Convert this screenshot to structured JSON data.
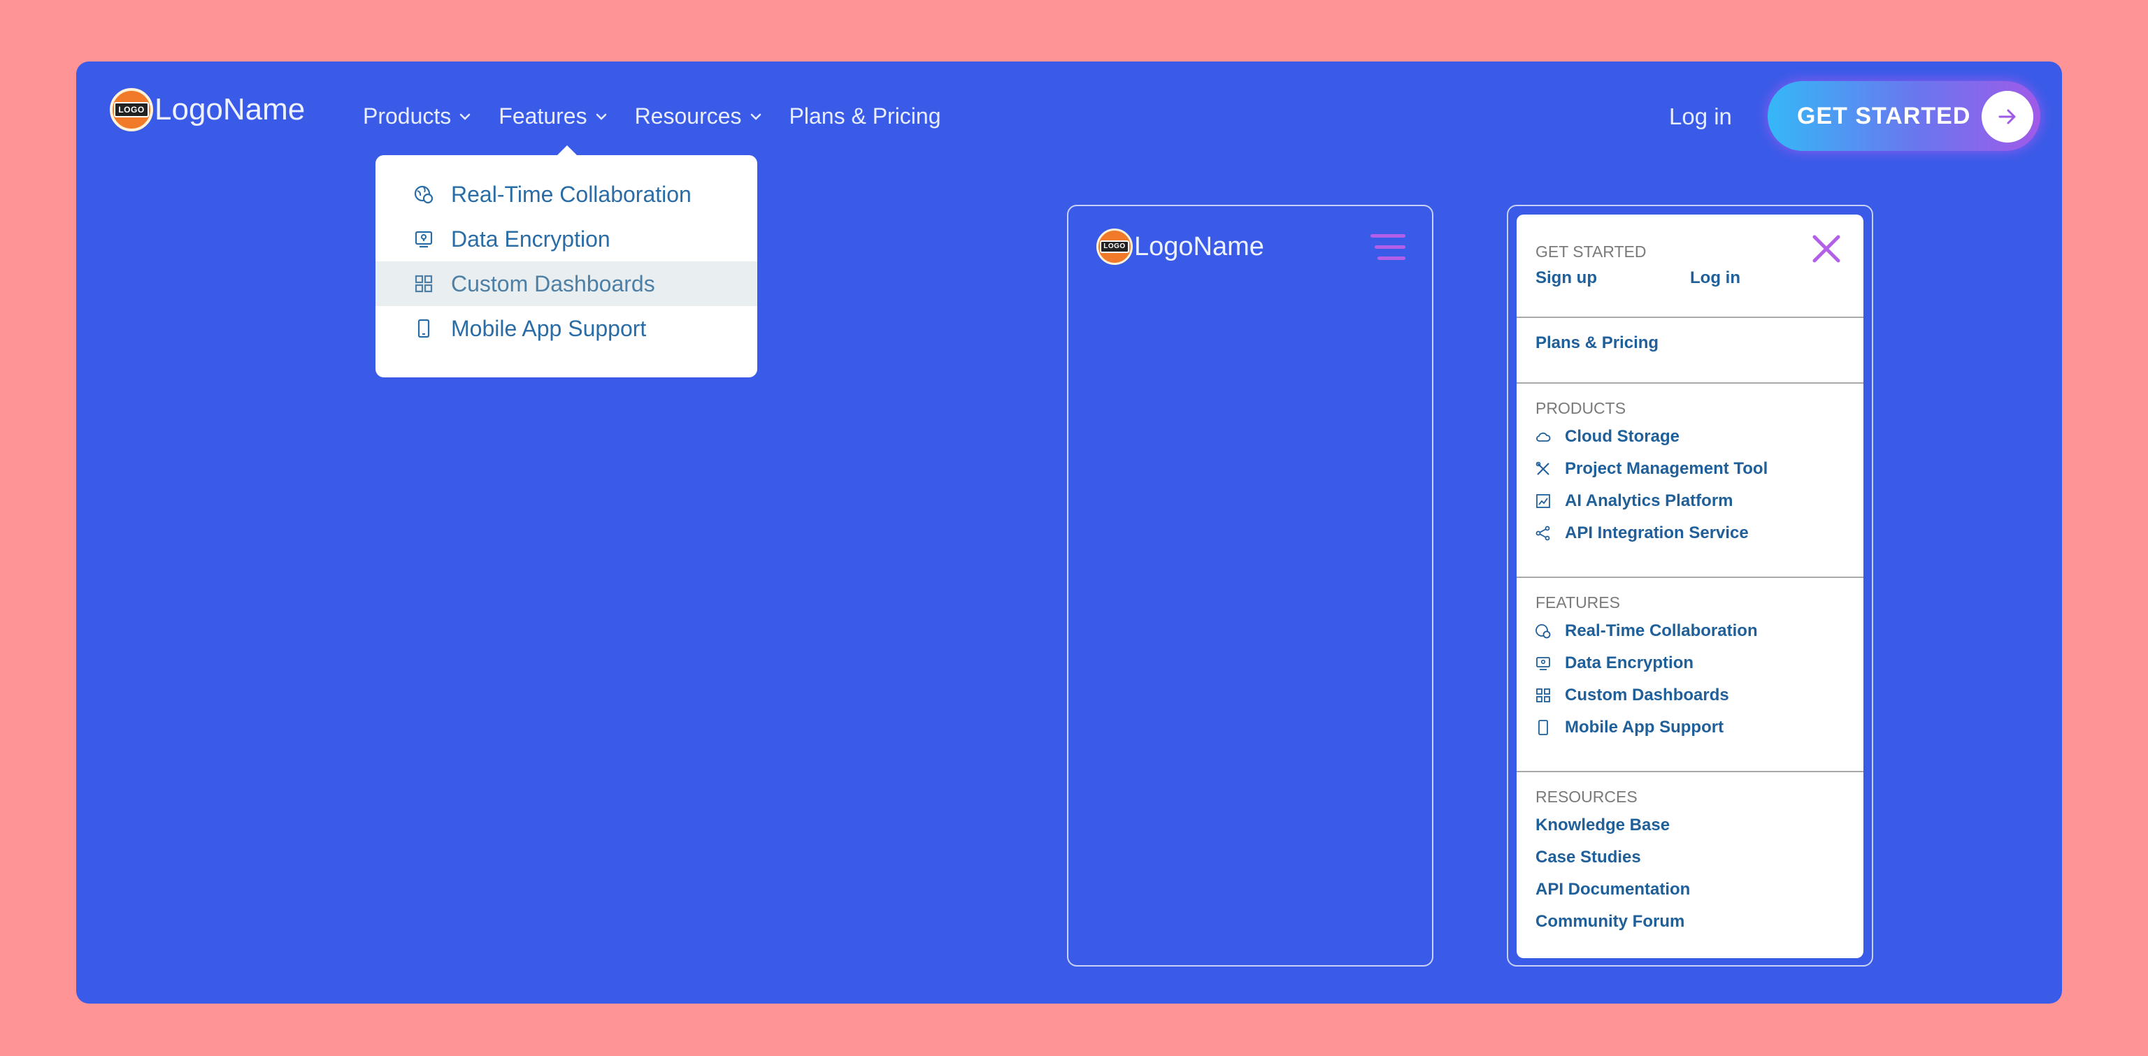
{
  "brand": {
    "logo_badge_text": "LOGO",
    "name": "LogoName"
  },
  "nav": {
    "items": [
      {
        "label": "Products",
        "has_dropdown": true
      },
      {
        "label": "Features",
        "has_dropdown": true
      },
      {
        "label": "Resources",
        "has_dropdown": true
      },
      {
        "label": "Plans & Pricing",
        "has_dropdown": false
      }
    ],
    "login": "Log in",
    "cta": "GET STARTED"
  },
  "features_dropdown": {
    "items": [
      {
        "label": "Real-Time Collaboration",
        "icon": "globe-refresh-icon"
      },
      {
        "label": "Data Encryption",
        "icon": "lock-screen-icon"
      },
      {
        "label": "Custom Dashboards",
        "icon": "grid-icon",
        "highlighted": true
      },
      {
        "label": "Mobile App Support",
        "icon": "phone-icon"
      }
    ]
  },
  "mobile_menu": {
    "get_started": {
      "heading": "GET STARTED",
      "signup": "Sign up",
      "login": "Log in"
    },
    "plans": "Plans & Pricing",
    "products": {
      "heading": "PRODUCTS",
      "items": [
        {
          "label": "Cloud Storage",
          "icon": "cloud-icon"
        },
        {
          "label": "Project Management Tool",
          "icon": "tools-icon"
        },
        {
          "label": "AI Analytics Platform",
          "icon": "chart-icon"
        },
        {
          "label": "API Integration Service",
          "icon": "share-nodes-icon"
        }
      ]
    },
    "features": {
      "heading": "FEATURES",
      "items": [
        {
          "label": "Real-Time Collaboration",
          "icon": "globe-refresh-icon"
        },
        {
          "label": "Data Encryption",
          "icon": "lock-screen-icon"
        },
        {
          "label": "Custom Dashboards",
          "icon": "grid-icon"
        },
        {
          "label": "Mobile App Support",
          "icon": "phone-icon"
        }
      ]
    },
    "resources": {
      "heading": "RESOURCES",
      "items": [
        "Knowledge Base",
        "Case Studies",
        "API Documentation",
        "Community Forum"
      ]
    }
  },
  "colors": {
    "page_bg": "#ff9496",
    "frame_bg": "#3a5be8",
    "link": "#1f5f9a",
    "accent_purple": "#b45fe8",
    "cta_gradient": [
      "#35b8f7",
      "#a05ae8"
    ]
  }
}
